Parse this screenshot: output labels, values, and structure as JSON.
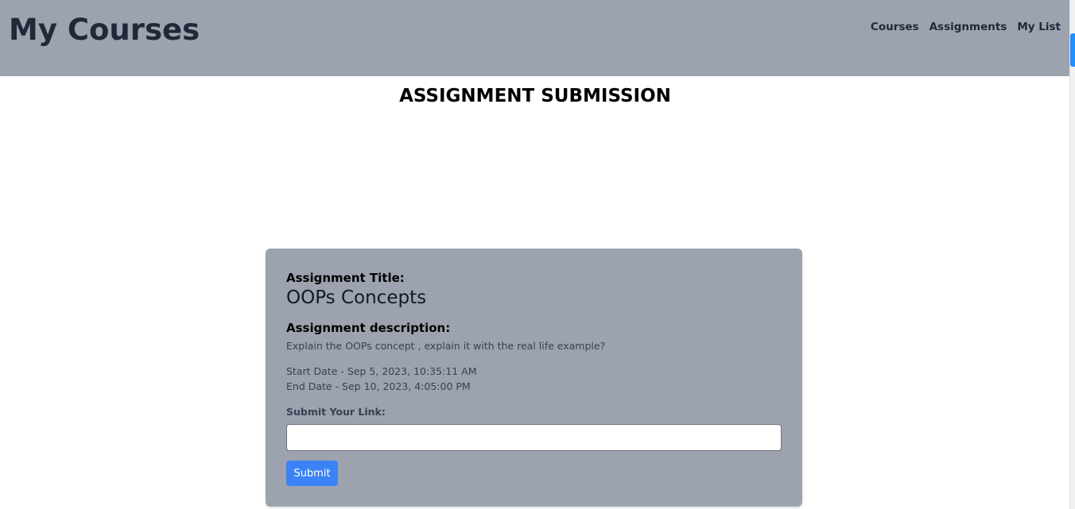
{
  "header": {
    "brand": "My Courses",
    "nav": {
      "courses": "Courses",
      "assignments": "Assignments",
      "my_list": "My List"
    }
  },
  "page": {
    "heading": "ASSIGNMENT SUBMISSION"
  },
  "assignment": {
    "title_label": "Assignment Title:",
    "title": "OOPs Concepts",
    "description_label": "Assignment description:",
    "description": "Explain the OOPs concept , explain it with the real life example?",
    "start_date": "Start Date - Sep 5, 2023, 10:35:11 AM",
    "end_date": "End Date - Sep 10, 2023, 4:05:00 PM"
  },
  "submission": {
    "link_label": "Submit Your Link:",
    "link_value": "",
    "submit_label": "Submit"
  },
  "colors": {
    "header_bg": "#9ca3af",
    "card_bg": "#9ca3af",
    "text_dark": "#1f2937",
    "button_bg": "#3b82f6",
    "scrollbar_thumb": "#1e90ff"
  }
}
